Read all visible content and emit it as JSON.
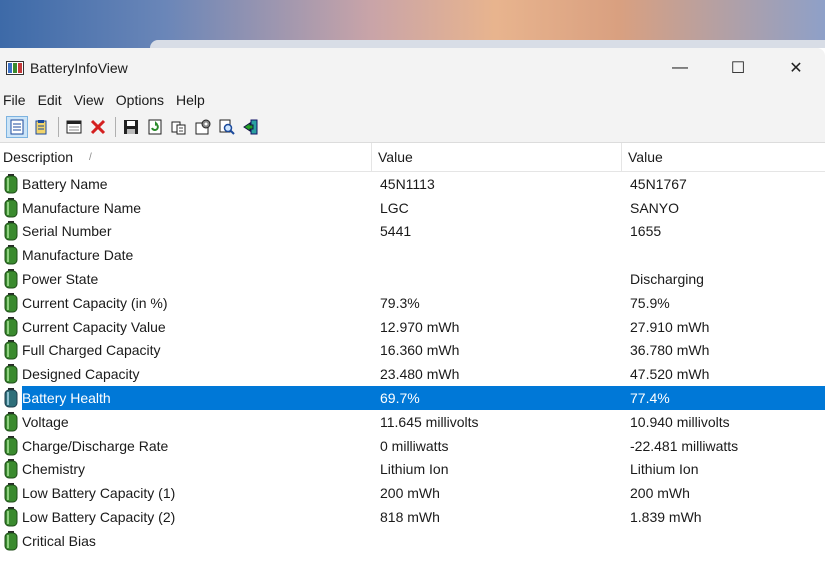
{
  "window": {
    "title": "BatteryInfoView",
    "minimize": "—",
    "maximize": "☐",
    "close": "✕"
  },
  "menu": [
    "File",
    "Edit",
    "View",
    "Options",
    "Help"
  ],
  "toolbar": {
    "icons": [
      "properties-icon",
      "report-icon",
      "window-icon",
      "delete-icon",
      "save-icon",
      "refresh-icon",
      "copy-icon",
      "options-icon",
      "search-icon",
      "exit-icon"
    ]
  },
  "columns": {
    "description": "Description",
    "value1": "Value",
    "value2": "Value",
    "sort_indicator": "/"
  },
  "rows": [
    {
      "label": "Battery Name",
      "v1": "45N1113",
      "v2": "45N1767"
    },
    {
      "label": "Manufacture Name",
      "v1": "LGC",
      "v2": "SANYO"
    },
    {
      "label": "Serial Number",
      "v1": " 5441",
      "v2": " 1655"
    },
    {
      "label": "Manufacture Date",
      "v1": "",
      "v2": ""
    },
    {
      "label": "Power State",
      "v1": "",
      "v2": "Discharging"
    },
    {
      "label": "Current Capacity (in %)",
      "v1": "79.3%",
      "v2": "75.9%"
    },
    {
      "label": "Current Capacity Value",
      "v1": "12.970 mWh",
      "v2": "27.910 mWh"
    },
    {
      "label": "Full Charged Capacity",
      "v1": "16.360 mWh",
      "v2": "36.780 mWh"
    },
    {
      "label": "Designed Capacity",
      "v1": "23.480 mWh",
      "v2": "47.520 mWh"
    },
    {
      "label": "Battery Health",
      "v1": "69.7%",
      "v2": "77.4%",
      "selected": true
    },
    {
      "label": "Voltage",
      "v1": "11.645 millivolts",
      "v2": "10.940 millivolts"
    },
    {
      "label": "Charge/Discharge Rate",
      "v1": "0 milliwatts",
      "v2": "-22.481 milliwatts"
    },
    {
      "label": "Chemistry",
      "v1": "Lithium Ion",
      "v2": "Lithium Ion"
    },
    {
      "label": "Low Battery Capacity (1)",
      "v1": "200 mWh",
      "v2": "200 mWh"
    },
    {
      "label": "Low Battery Capacity (2)",
      "v1": "818 mWh",
      "v2": "1.839 mWh"
    },
    {
      "label": "Critical Bias",
      "v1": "",
      "v2": ""
    }
  ],
  "colors": {
    "selection": "#0078d7",
    "battery_icon": "#3a8a2e"
  }
}
